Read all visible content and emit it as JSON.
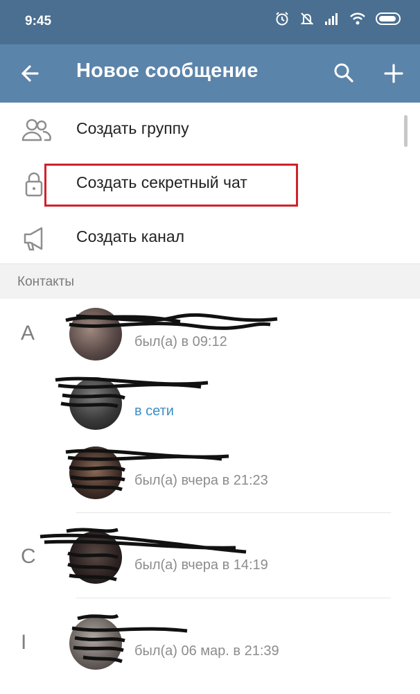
{
  "status_bar": {
    "time": "9:45",
    "icons": [
      "alarm-icon",
      "mute-icon",
      "signal-icon",
      "wifi-icon",
      "battery-icon"
    ]
  },
  "app_bar": {
    "title": "Новое сообщение",
    "back_icon": "arrow-back-icon",
    "search_icon": "search-icon",
    "add_icon": "plus-icon"
  },
  "menu": [
    {
      "label": "Создать группу",
      "icon": "group-icon"
    },
    {
      "label": "Создать секретный чат",
      "icon": "lock-icon"
    },
    {
      "label": "Создать канал",
      "icon": "megaphone-icon"
    }
  ],
  "contacts_header": "Контакты",
  "contacts": [
    {
      "letter": "A",
      "name": "",
      "status": "был(а) в 09:12",
      "online": false
    },
    {
      "letter": "",
      "name": "",
      "status": "в сети",
      "online": true
    },
    {
      "letter": "",
      "name": "",
      "status": "был(а) вчера в 21:23",
      "online": false
    },
    {
      "letter": "C",
      "name": "",
      "status": "был(а) вчера в 14:19",
      "online": false
    },
    {
      "letter": "I",
      "name": "",
      "status": "был(а) 06 мар. в 21:39",
      "online": false
    }
  ],
  "colors": {
    "status_bar": "#4a6f91",
    "app_bar": "#5b84aa",
    "highlight": "#d0212b",
    "online": "#3a8fc4"
  }
}
